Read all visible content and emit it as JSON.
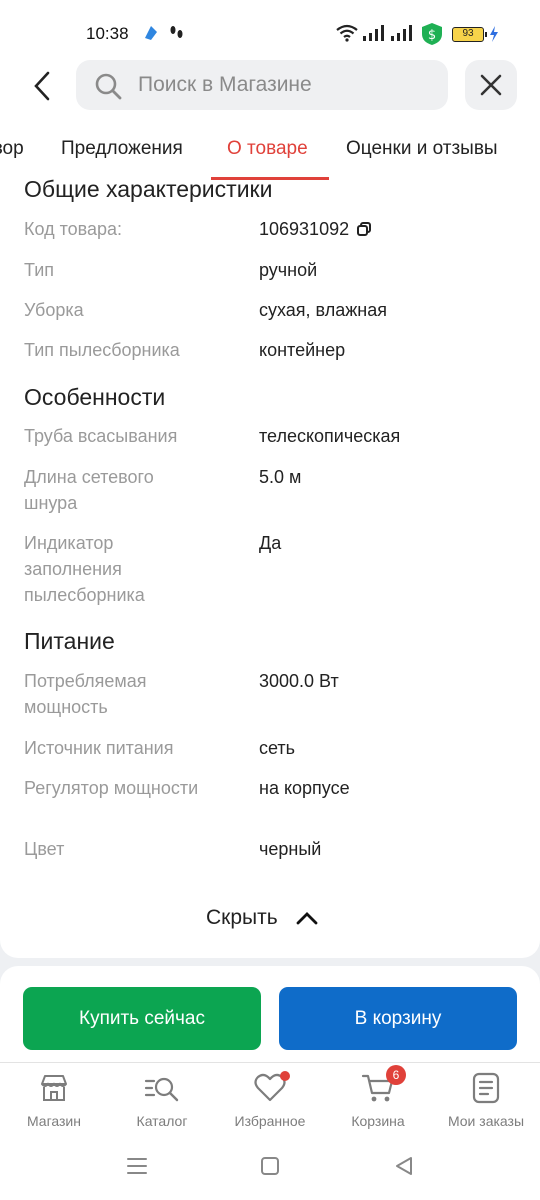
{
  "status_bar": {
    "time": "10:38",
    "battery": "93"
  },
  "search": {
    "placeholder": "Поиск в Магазине"
  },
  "tabs": [
    {
      "label": "зор"
    },
    {
      "label": "Предложения"
    },
    {
      "label": "О товаре",
      "active": true
    },
    {
      "label": "Оценки и отзывы"
    }
  ],
  "sections": {
    "general": {
      "title": "Общие характеристики",
      "rows": [
        {
          "label": "Код товара:",
          "value": "106931092"
        },
        {
          "label": "Тип",
          "value": "ручной"
        },
        {
          "label": "Уборка",
          "value": "сухая, влажная"
        },
        {
          "label": "Тип пылесборника",
          "value": "контейнер"
        }
      ]
    },
    "features": {
      "title": "Особенности",
      "rows": [
        {
          "label": "Труба всасывания",
          "value": "телескопическая"
        },
        {
          "label": "Длина сетевого шнура",
          "value": "5.0 м"
        },
        {
          "label": "Индикатор заполнения пылесборника",
          "value": "Да"
        }
      ]
    },
    "power": {
      "title": "Питание",
      "rows": [
        {
          "label": "Потребляемая мощность",
          "value": "3000.0 Вт"
        },
        {
          "label": "Источник питания",
          "value": "сеть"
        },
        {
          "label": "Регулятор мощности",
          "value": "на корпусе"
        }
      ]
    },
    "other": {
      "rows": [
        {
          "label": "Цвет",
          "value": "черный"
        }
      ]
    }
  },
  "hide_button": {
    "label": "Скрыть"
  },
  "actions": {
    "buy_now": "Купить сейчас",
    "add_to_cart": "В корзину"
  },
  "bottom_nav": [
    {
      "label": "Магазин",
      "icon": "shop-icon"
    },
    {
      "label": "Каталог",
      "icon": "catalog-search-icon"
    },
    {
      "label": "Избранное",
      "icon": "heart-icon"
    },
    {
      "label": "Корзина",
      "icon": "cart-icon",
      "badge": "6"
    },
    {
      "label": "Мои заказы",
      "icon": "orders-icon"
    }
  ],
  "colors": {
    "accent": "#e0413a",
    "buy": "#0ca551",
    "cart": "#0f6cc9"
  }
}
